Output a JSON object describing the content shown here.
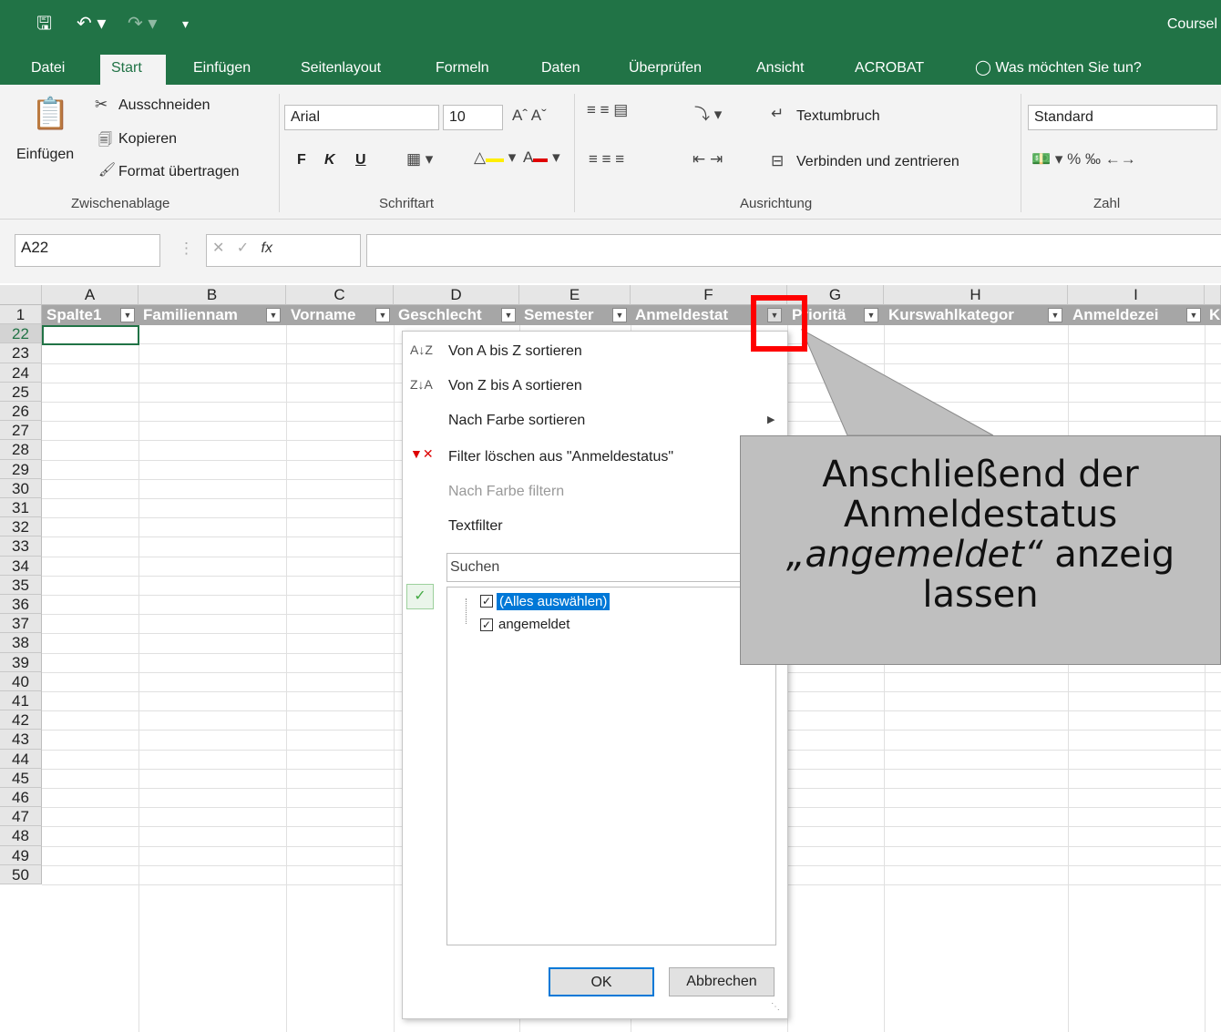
{
  "titlebar": {
    "title": "Coursel"
  },
  "tabs": [
    "Datei",
    "Start",
    "Einfügen",
    "Seitenlayout",
    "Formeln",
    "Daten",
    "Überprüfen",
    "Ansicht",
    "ACROBAT"
  ],
  "tell_me": "Was möchten Sie tun?",
  "ribbon": {
    "clipboard": {
      "paste": "Einfügen",
      "cut": "Ausschneiden",
      "copy": "Kopieren",
      "format_painter": "Format übertragen",
      "group": "Zwischenablage"
    },
    "font": {
      "name": "Arial",
      "size": "10",
      "bold": "F",
      "italic": "K",
      "underline": "U",
      "group": "Schriftart"
    },
    "alignment": {
      "wrap": "Textumbruch",
      "merge": "Verbinden und zentrieren",
      "group": "Ausrichtung"
    },
    "number": {
      "format": "Standard",
      "group": "Zahl"
    }
  },
  "formula_bar": {
    "name_box": "A22",
    "fx": "fx",
    "content": ""
  },
  "columns": [
    "A",
    "B",
    "C",
    "D",
    "E",
    "F",
    "G",
    "H",
    "I"
  ],
  "headers": [
    "Spalte1",
    "Familiennam",
    "Vorname",
    "Geschlecht",
    "Semester",
    "Anmeldestat",
    "Prioritä",
    "Kurswahlkategor",
    "Anmeldezei",
    "K"
  ],
  "rows": [
    "1",
    "22",
    "23",
    "24",
    "25",
    "26",
    "27",
    "28",
    "29",
    "30",
    "31",
    "32",
    "33",
    "34",
    "35",
    "36",
    "37",
    "38",
    "39",
    "40",
    "41",
    "42",
    "43",
    "44",
    "45",
    "46",
    "47",
    "48",
    "49",
    "50"
  ],
  "filter_menu": {
    "sort_az": "Von A bis Z sortieren",
    "sort_za": "Von Z bis A sortieren",
    "sort_color": "Nach Farbe sortieren",
    "clear_filter": "Filter löschen aus \"Anmeldestatus\"",
    "filter_color": "Nach Farbe filtern",
    "text_filter": "Textfilter",
    "search_placeholder": "Suchen",
    "select_all": "(Alles auswählen)",
    "value_1": "angemeldet",
    "ok": "OK",
    "cancel": "Abbrechen"
  },
  "callout": {
    "line1": "Anschließend der",
    "line2": "Anmeldestatus",
    "line3_italic": "„angemeldet“",
    "line3_rest": " anzeig",
    "line4": "lassen"
  },
  "colors": {
    "excel_green": "#217346",
    "header_gray": "#a6a6a6",
    "highlight_red": "#ff0000",
    "callout_gray": "#bfbfbf"
  }
}
